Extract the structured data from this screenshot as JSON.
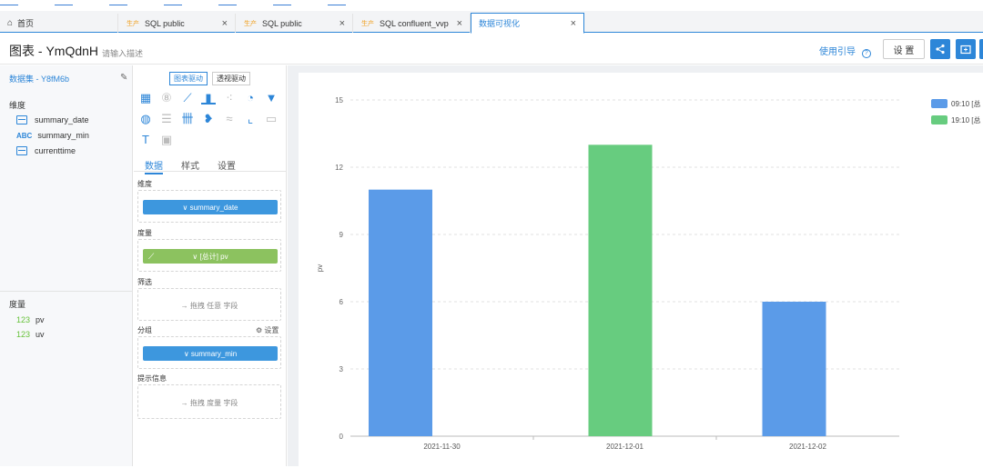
{
  "tabs": [
    {
      "label": "首页",
      "icon": "home-icon"
    },
    {
      "label": "SQL public",
      "env": "生产",
      "close": "×"
    },
    {
      "label": "SQL public",
      "env": "生产",
      "close": "×"
    },
    {
      "label": "SQL confluent_vvp",
      "env": "生产",
      "close": "×"
    },
    {
      "label": "数据可视化",
      "close": "×",
      "active": true
    }
  ],
  "header": {
    "title": "图表 - YmQdnH",
    "description_placeholder": "请输入描述",
    "guide_label": "使用引导",
    "settings_label": "设 置"
  },
  "left": {
    "dataset": "数据集 - Y8fM6b",
    "dimensions_title": "维度",
    "dimensions": [
      {
        "type": "date",
        "name": "summary_date"
      },
      {
        "type": "ABC",
        "name": "summary_min"
      },
      {
        "type": "date",
        "name": "currenttime"
      }
    ],
    "measures_title": "度量",
    "measures": [
      {
        "type": "123",
        "name": "pv"
      },
      {
        "type": "123",
        "name": "uv"
      }
    ]
  },
  "config": {
    "drive_chart": "图表驱动",
    "drive_pivot": "透视驱动",
    "tabs": [
      "数据",
      "样式",
      "设置"
    ],
    "dimension_label": "维度",
    "dimension_value": "∨ summary_date",
    "measure_label": "度量",
    "measure_value": "∨ [总计] pv",
    "filter_label": "筛选",
    "filter_hint": "→ 拖拽 任意 字段",
    "group_label": "分组",
    "group_settings": "设置",
    "group_value": "∨ summary_min",
    "tooltip_label": "提示信息",
    "tooltip_hint": "→ 拖拽 度量 字段"
  },
  "chart_data": {
    "type": "bar",
    "ylabel": "pv",
    "xlabel": "",
    "ylim": [
      0,
      15
    ],
    "yticks": [
      0,
      3,
      6,
      9,
      12,
      15
    ],
    "categories": [
      "2021-11-30",
      "2021-12-01",
      "2021-12-02"
    ],
    "series": [
      {
        "name": "09:10 [总",
        "color": "#5b9be8",
        "values": [
          11,
          null,
          6
        ]
      },
      {
        "name": "19:10 [总",
        "color": "#67cc7f",
        "values": [
          null,
          13,
          null
        ]
      }
    ],
    "legend_position": "top-right",
    "grid": true
  }
}
